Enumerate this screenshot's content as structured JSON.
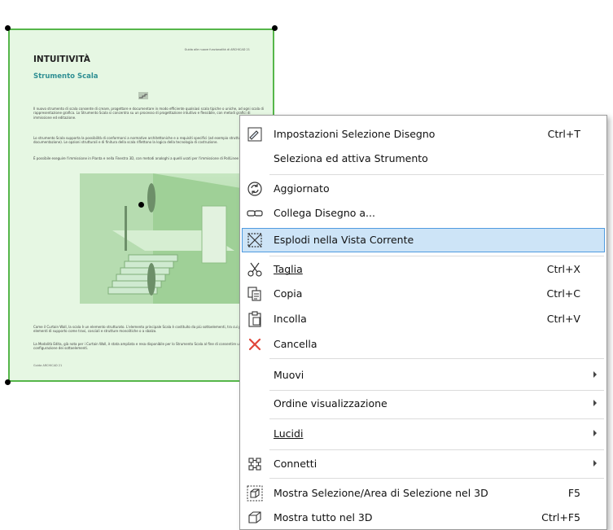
{
  "document": {
    "header": "Guida alle nuove funzionalità di ARCHICAD 21",
    "title": "INTUITIVITÀ",
    "subtitle": "Strumento Scala",
    "paragraph_1": "Il nuovo strumento di scala consente di creare, progettare e documentare in modo efficiente qualsiasi scala tipiche o uniche, ad ogni scala di rappresentazione grafica. Lo Strumento Scala si concentra su un processo di progettazione intuitivo e flessibile, con metodi grafici di immissione ed editazione.",
    "paragraph_2": "Lo strumento Scala supporta la possibilità di conformarsi a normative architettoniche e a requisiti specifici (ad esempio strutturali o di documentazione). Le opzioni strutturali e di finitura della scala riflettono la logica della tecnologia di costruzione.",
    "paragraph_3": "È possibile eseguire l'immissione in Pianta e nella Finestra 3D, con metodi analoghi a quelli usati per l'immissione di Pol/Linee e Muri.",
    "paragraph_4": "Come il Curtain Wall, la scala è un elemento strutturato. L'elemento principale Scala è costituito da più sottoelementi, tra cui pedate, alzate ed elementi di supporto come travi, cosciali e strutture monolitiche o a sbalzo.",
    "paragraph_5": "La Modalità Edita, già nota per i Curtain Wall, è stata ampliata e resa disponibile per lo Strumento Scala al fine di consentire una facile configurazione dei sottoelementi.",
    "footer": "Guida ARCHICAD 21"
  },
  "menu": {
    "items": [
      {
        "icon": "drawing-settings-icon",
        "label": "Impostazioni Selezione Disegno",
        "shortcut": "Ctrl+T"
      },
      {
        "icon": "",
        "label": "Seleziona ed attiva Strumento",
        "shortcut": ""
      },
      {
        "icon": "update-icon",
        "label": "Aggiornato",
        "shortcut": ""
      },
      {
        "icon": "link-icon",
        "label": "Collega Disegno a...",
        "shortcut": ""
      },
      {
        "icon": "explode-icon",
        "label": "Esplodi nella Vista Corrente",
        "shortcut": ""
      },
      {
        "icon": "scissors-icon",
        "label": "Taglia",
        "shortcut": "Ctrl+X"
      },
      {
        "icon": "copy-icon",
        "label": "Copia",
        "shortcut": "Ctrl+C"
      },
      {
        "icon": "paste-icon",
        "label": "Incolla",
        "shortcut": "Ctrl+V"
      },
      {
        "icon": "delete-icon",
        "label": "Cancella",
        "shortcut": ""
      },
      {
        "icon": "",
        "label": "Muovi",
        "shortcut": ""
      },
      {
        "icon": "",
        "label": "Ordine visualizzazione",
        "shortcut": ""
      },
      {
        "icon": "",
        "label": "Lucidi",
        "shortcut": ""
      },
      {
        "icon": "connect-icon",
        "label": "Connetti",
        "shortcut": ""
      },
      {
        "icon": "show-selection-3d-icon",
        "label": "Mostra Selezione/Area di Selezione nel 3D",
        "shortcut": "F5"
      },
      {
        "icon": "show-all-3d-icon",
        "label": "Mostra tutto nel 3D",
        "shortcut": "Ctrl+F5"
      }
    ],
    "highlighted_item": "Esplodi nella Vista Corrente"
  },
  "colors": {
    "drawing_background": "#e6f7e3",
    "drawing_border": "#56b64a",
    "menu_highlight": "#cde4f7",
    "menu_highlight_border": "#4f9be0",
    "delete_icon": "#e0463a",
    "doc_subtitle": "#2f8f93"
  }
}
